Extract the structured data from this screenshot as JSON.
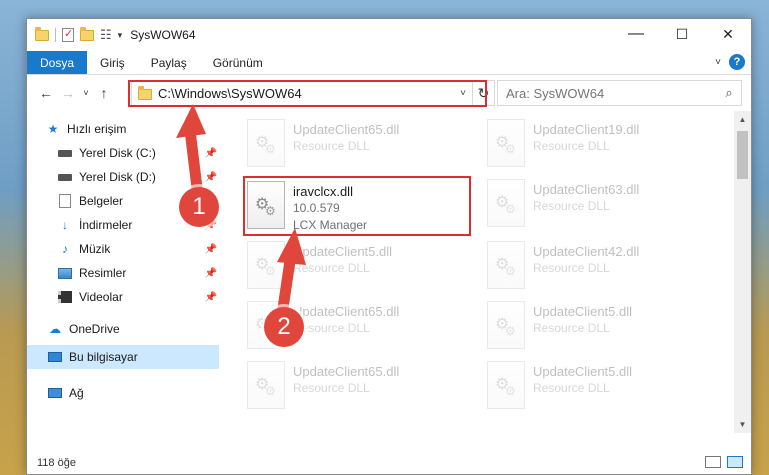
{
  "window": {
    "title": "SysWOW64",
    "controls": {
      "minimize": "—",
      "maximize": "☐",
      "close": "✕"
    }
  },
  "ribbon": {
    "tabs": [
      "Dosya",
      "Giriş",
      "Paylaş",
      "Görünüm"
    ],
    "help": "?"
  },
  "nav": {
    "back": "←",
    "forward": "→",
    "recent": "˅",
    "up": "↑",
    "address": "C:\\Windows\\SysWOW64",
    "refresh": "↻",
    "search_placeholder": "Ara: SysWOW64"
  },
  "sidebar": {
    "items": [
      {
        "label": "Hızlı erişim",
        "icon": "star-icon"
      },
      {
        "label": "Yerel Disk (C:)",
        "icon": "drive-icon",
        "pinned": true
      },
      {
        "label": "Yerel Disk (D:)",
        "icon": "drive-icon",
        "pinned": true
      },
      {
        "label": "Belgeler",
        "icon": "documents-icon",
        "pinned": true
      },
      {
        "label": "İndirmeler",
        "icon": "downloads-icon",
        "pinned": true
      },
      {
        "label": "Müzik",
        "icon": "music-icon",
        "pinned": true
      },
      {
        "label": "Resimler",
        "icon": "pictures-icon",
        "pinned": true
      },
      {
        "label": "Videolar",
        "icon": "videos-icon",
        "pinned": true
      },
      {
        "label": "OneDrive",
        "icon": "cloud-icon"
      },
      {
        "label": "Bu bilgisayar",
        "icon": "computer-icon",
        "selected": true
      },
      {
        "label": "Ağ",
        "icon": "network-icon"
      }
    ]
  },
  "files": {
    "left": [
      {
        "name": "UpdateClient65.dll",
        "desc": "Resource DLL"
      },
      {
        "name": "iravclcx.dll",
        "version": "10.0.579",
        "desc": "LCX Manager",
        "highlighted": true
      },
      {
        "name": "UpdateClient5.dll",
        "desc": "Resource DLL"
      },
      {
        "name": "UpdateClient65.dll",
        "desc": "Resource DLL"
      },
      {
        "name": "UpdateClient65.dll",
        "desc": "Resource DLL"
      }
    ],
    "right": [
      {
        "name": "UpdateClient19.dll",
        "desc": "Resource DLL"
      },
      {
        "name": "UpdateClient63.dll",
        "desc": "Resource DLL"
      },
      {
        "name": "UpdateClient42.dll",
        "desc": "Resource DLL"
      },
      {
        "name": "UpdateClient5.dll",
        "desc": "Resource DLL"
      },
      {
        "name": "UpdateClient5.dll",
        "desc": "Resource DLL"
      }
    ]
  },
  "status": {
    "count": "118 öğe"
  },
  "callouts": [
    "1",
    "2"
  ],
  "colors": {
    "accent": "#1979ca",
    "highlight": "#d9302f",
    "callout": "#e0463c",
    "selected": "#cce8ff"
  }
}
